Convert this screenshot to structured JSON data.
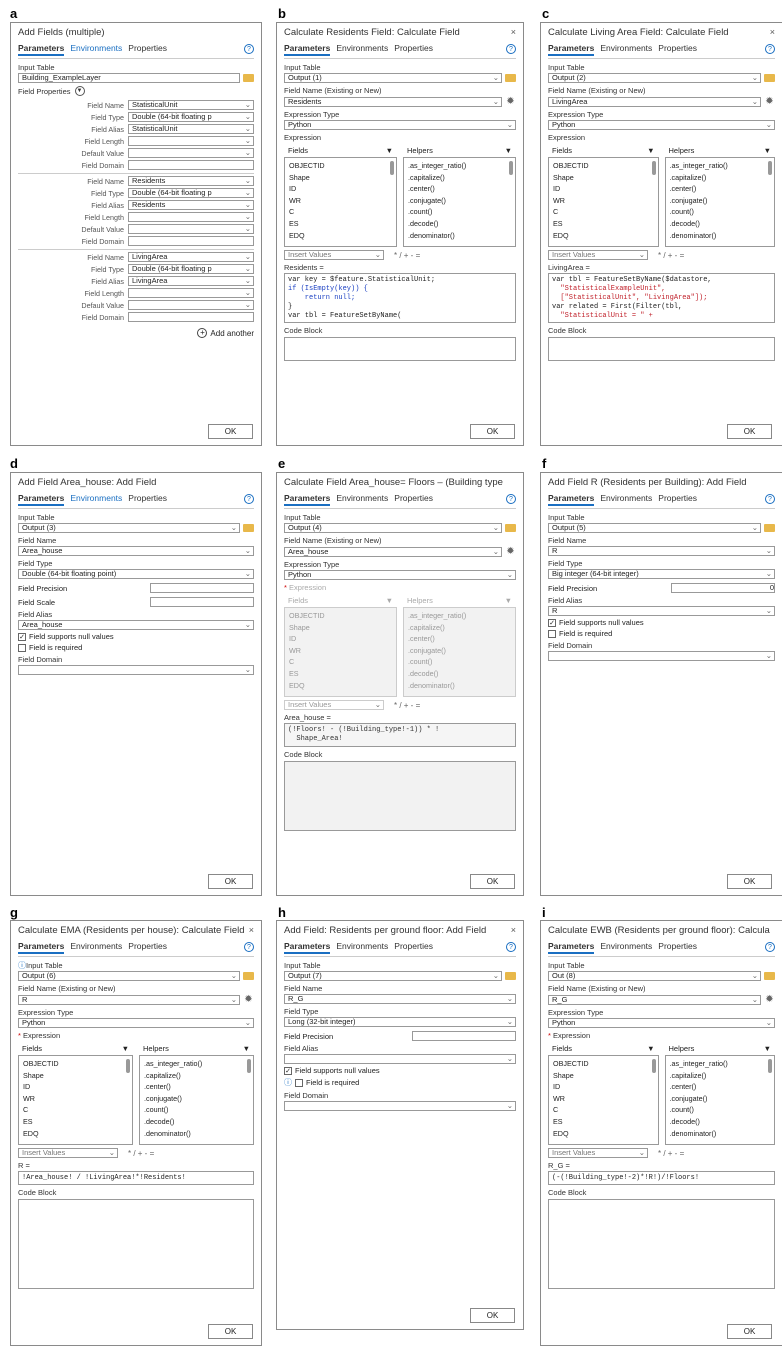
{
  "panel_letters": [
    "a",
    "b",
    "c",
    "d",
    "e",
    "f",
    "g",
    "h",
    "i"
  ],
  "tabs": {
    "parameters": "Parameters",
    "environments": "Environments",
    "properties": "Properties"
  },
  "common": {
    "input_table": "Input Table",
    "field_name_existing": "Field Name (Existing or New)",
    "expression_type": "Expression Type",
    "python": "Python",
    "expression": "Expression",
    "fields": "Fields",
    "helpers": "Helpers",
    "insert_values": "Insert Values",
    "operators": "*   /   +   -   =",
    "code_block": "Code Block",
    "ok": "OK",
    "close": "×",
    "help": "?",
    "field_name": "Field Name",
    "field_type": "Field Type",
    "field_precision": "Field Precision",
    "field_scale": "Field Scale",
    "field_alias": "Field Alias",
    "field_domain": "Field Domain",
    "null_values": "Field supports null values",
    "required": "Field is required",
    "field_length": "Field Length",
    "default_value": "Default Value"
  },
  "fields_list": [
    "OBJECTID",
    "Shape",
    "ID",
    "WR",
    "C",
    "ES",
    "EDQ"
  ],
  "helpers_list": [
    ".as_integer_ratio()",
    ".capitalize()",
    ".center()",
    ".conjugate()",
    ".count()",
    ".decode()",
    ".denominator()"
  ],
  "a": {
    "title": "Add Fields (multiple)",
    "input_table": "Building_ExampleLayer",
    "field_properties": "Field Properties",
    "add_another": "Add another",
    "groups": [
      {
        "name": "StatisticalUnit",
        "type": "Double (64-bit floating p",
        "alias": "StatisticalUnit"
      },
      {
        "name": "Residents",
        "type": "Double (64-bit floating p",
        "alias": "Residents"
      },
      {
        "name": "LivingArea",
        "type": "Double (64-bit floating p",
        "alias": "LivingArea"
      }
    ]
  },
  "b": {
    "title": "Calculate Residents Field: Calculate Field",
    "input": "Output (1)",
    "field": "Residents",
    "expr_label": "Residents =",
    "code": [
      "var key = $feature.StatisticalUnit;",
      "if (IsEmpty(key)) {",
      "    return null;",
      "}",
      "var tbl = FeatureSetByName("
    ]
  },
  "c": {
    "title": "Calculate Living Area Field: Calculate Field",
    "input": "Output (2)",
    "field": "LivingArea",
    "expr_label": "LivingArea =",
    "code": [
      "var tbl = FeatureSetByName($datastore,",
      "  \"StatisticalExampleUnit\",",
      "  [\"StatisticalUnit\", \"LivingArea\"]);",
      "var related = First(Filter(tbl,",
      "  \"StatisticalUnit = \" +"
    ]
  },
  "d": {
    "title": "Add Field Area_house: Add Field",
    "input": "Output (3)",
    "name": "Area_house",
    "type": "Double (64-bit floating point)",
    "alias": "Area_house"
  },
  "e": {
    "title": "Calculate Field Area_house= Floors – (Building type",
    "input": "Output (4)",
    "field": "Area_house",
    "expr_label": "Area_house =",
    "code": [
      "(!Floors! - (!Building_type!-1)) * !",
      "  Shape_Area!"
    ]
  },
  "f": {
    "title": "Add Field R (Residents per Building): Add Field",
    "input": "Output (5)",
    "name": "R",
    "type": "Big integer (64-bit integer)",
    "alias": "R",
    "precision": "0"
  },
  "g": {
    "title": "Calculate EMA (Residents per house): Calculate Field",
    "input": "Output (6)",
    "field": "R",
    "expr_label": "R =",
    "code": [
      "!Area_house! / !LivingArea!*!Residents!"
    ]
  },
  "h": {
    "title": "Add Field: Residents per ground floor: Add Field",
    "input": "Output (7)",
    "name": "R_G",
    "type": "Long (32-bit integer)"
  },
  "i": {
    "title": "Calculate EWB (Residents per ground floor): Calcula",
    "input": "Out (8)",
    "field": "R_G",
    "expr_label": "R_G =",
    "code": [
      "(-(!Building_type!-2)*!R!)/!Floors!"
    ]
  }
}
